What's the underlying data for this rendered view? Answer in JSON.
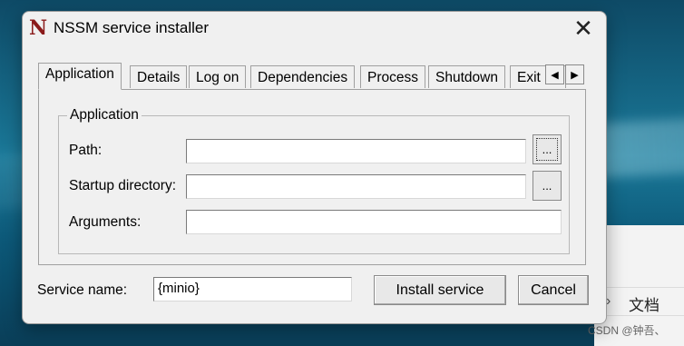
{
  "background": {
    "explorer_item": "文档",
    "watermark": "CSDN @钟吾、"
  },
  "window": {
    "logo": "N",
    "title": "NSSM service installer",
    "close_glyph": "✕"
  },
  "tabs": [
    "Application",
    "Details",
    "Log on",
    "Dependencies",
    "Process",
    "Shutdown",
    "Exit"
  ],
  "tab_scroll": {
    "left": "◀",
    "right": "▶"
  },
  "application": {
    "group_label": "Application",
    "path_label": "Path:",
    "path_value": "",
    "startup_label": "Startup directory:",
    "startup_value": "",
    "arguments_label": "Arguments:",
    "arguments_value": "",
    "browse_label": "..."
  },
  "footer": {
    "service_name_label": "Service name:",
    "service_name_value": "{minio}",
    "install_label": "Install service",
    "cancel_label": "Cancel"
  }
}
